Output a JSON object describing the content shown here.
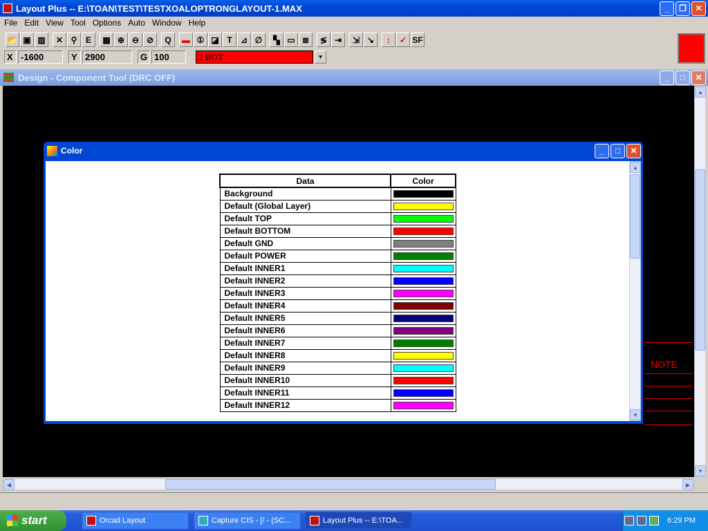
{
  "app": {
    "title": "Layout Plus -- E:\\TOAN\\TEST\\TESTXOALOPTRONGLAYOUT-1.MAX"
  },
  "menu": [
    "File",
    "Edit",
    "View",
    "Tool",
    "Options",
    "Auto",
    "Window",
    "Help"
  ],
  "toolbar": {
    "icons": [
      "open-icon",
      "save-icon",
      "library-icon",
      "delete-icon",
      "find-icon",
      "edit-icon",
      "grid-icon",
      "zoom-in-icon",
      "zoom-out-icon",
      "zoom-all-icon",
      "query-icon",
      "component-icon",
      "pin-icon",
      "obstacle-icon",
      "text-icon",
      "connection-icon",
      "error-icon",
      "color-icon",
      "drc-box-icon",
      "spreadsheet-icon",
      "route-icon",
      "shove-icon",
      "reconnect-icon",
      "auto-path-icon",
      "drc-route-icon",
      "online-drc-icon",
      "sf-icon"
    ]
  },
  "coords": {
    "x_label": "X",
    "x": "-1600",
    "y_label": "Y",
    "y": "2900",
    "g_label": "G",
    "g": "100",
    "layer": "2  BOT",
    "layer_color": "#ff0000"
  },
  "design_window": {
    "title": "Design - Component Tool (DRC OFF)",
    "note": "NOTE"
  },
  "color_dialog": {
    "title": "Color",
    "headers": [
      "Data",
      "Color"
    ],
    "rows": [
      {
        "label": "Background",
        "color": "#000000"
      },
      {
        "label": "Default (Global Layer)",
        "color": "#ffff00"
      },
      {
        "label": "Default TOP",
        "color": "#00ff00"
      },
      {
        "label": "Default BOTTOM",
        "color": "#ff0000"
      },
      {
        "label": "Default GND",
        "color": "#808080"
      },
      {
        "label": "Default POWER",
        "color": "#008000"
      },
      {
        "label": "Default INNER1",
        "color": "#00ffff"
      },
      {
        "label": "Default INNER2",
        "color": "#0000ff"
      },
      {
        "label": "Default INNER3",
        "color": "#ff00ff"
      },
      {
        "label": "Default INNER4",
        "color": "#800000"
      },
      {
        "label": "Default INNER5",
        "color": "#000080"
      },
      {
        "label": "Default INNER6",
        "color": "#800080"
      },
      {
        "label": "Default INNER7",
        "color": "#008000"
      },
      {
        "label": "Default INNER8",
        "color": "#ffff00"
      },
      {
        "label": "Default INNER9",
        "color": "#00ffff"
      },
      {
        "label": "Default INNER10",
        "color": "#ff0000"
      },
      {
        "label": "Default INNER11",
        "color": "#0000ff"
      },
      {
        "label": "Default INNER12",
        "color": "#ff00ff"
      }
    ]
  },
  "taskbar": {
    "start": "start",
    "items": [
      "Orcad Layout",
      "Capture CIS - [/ - (SC...",
      "Layout Plus -- E:\\TOA..."
    ],
    "clock": "6:29 PM"
  }
}
